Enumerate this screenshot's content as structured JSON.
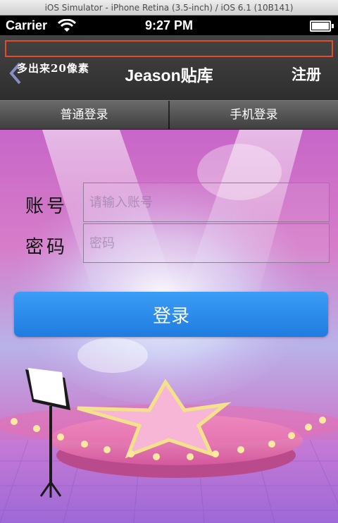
{
  "window": {
    "title": "iOS Simulator - iPhone Retina (3.5-inch) / iOS 6.1 (10B141)"
  },
  "statusbar": {
    "carrier": "Carrier",
    "time": "9:27 PM"
  },
  "navbar": {
    "annotation": "多出来20像素",
    "title": "Jeason贴库",
    "register_label": "注册"
  },
  "tabs": [
    {
      "label": "普通登录"
    },
    {
      "label": "手机登录"
    }
  ],
  "form": {
    "account_label": "账号",
    "account_placeholder": "请输入账号",
    "password_label": "密码",
    "password_placeholder": "密码",
    "login_label": "登录"
  },
  "colors": {
    "annotation_box": "#e34b2a",
    "login_button": "#2a8de9",
    "navbar": "#3a3a3a",
    "background": "#d27ac8"
  }
}
